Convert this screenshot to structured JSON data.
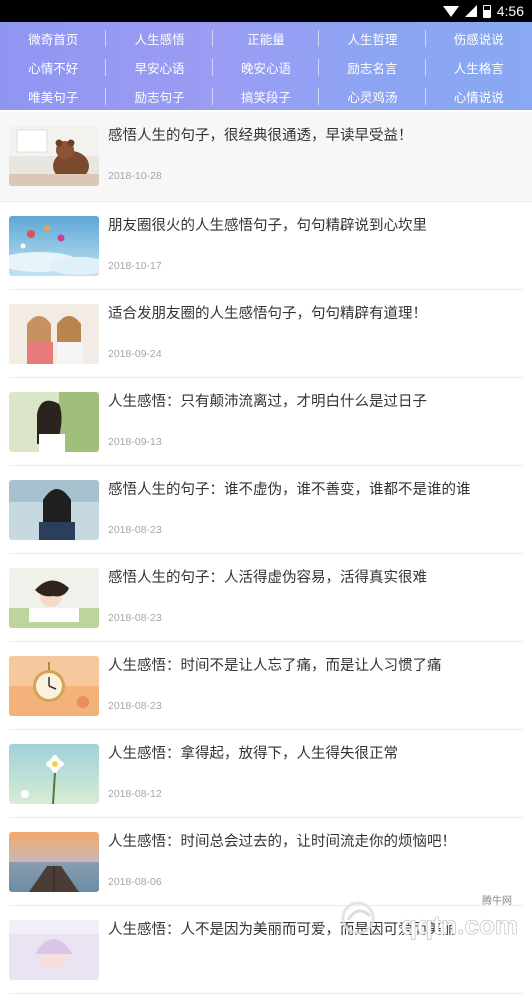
{
  "status_bar": {
    "time": "4:56",
    "battery_level": 0.6
  },
  "nav": [
    [
      "微奇首页",
      "人生感悟",
      "正能量",
      "人生哲理",
      "伤感说说"
    ],
    [
      "心情不好",
      "早安心语",
      "晚安心语",
      "励志名言",
      "人生格言"
    ],
    [
      "唯美句子",
      "励志句子",
      "搞笑段子",
      "心灵鸡汤",
      "心情说说"
    ]
  ],
  "articles": [
    {
      "title": "感悟人生的句子，很经典很通透，早读早受益！",
      "date": "2018-10-28",
      "thumb": "teddy-bear-window"
    },
    {
      "title": "朋友圈很火的人生感悟句子，句句精辟说到心坎里",
      "date": "2018-10-17",
      "thumb": "sky-balloons"
    },
    {
      "title": "适合发朋友圈的人生感悟句子，句句精辟有道理！",
      "date": "2018-09-24",
      "thumb": "two-girls"
    },
    {
      "title": "人生感悟：只有颠沛流离过，才明白什么是过日子",
      "date": "2018-09-13",
      "thumb": "girl-profile"
    },
    {
      "title": "感悟人生的句子：谁不虚伪，谁不善变，谁都不是谁的谁",
      "date": "2018-08-23",
      "thumb": "girl-glasses"
    },
    {
      "title": "感悟人生的句子：人活得虚伪容易，活得真实很难",
      "date": "2018-08-23",
      "thumb": "girl-lying"
    },
    {
      "title": "人生感悟：时间不是让人忘了痛，而是让人习惯了痛",
      "date": "2018-08-23",
      "thumb": "pocket-watch"
    },
    {
      "title": "人生感悟：拿得起，放得下，人生得失很正常",
      "date": "2018-08-12",
      "thumb": "white-flower"
    },
    {
      "title": "人生感悟：时间总会过去的，让时间流走你的烦恼吧！",
      "date": "2018-08-06",
      "thumb": "pier-sunset"
    },
    {
      "title": "人生感悟：人不是因为美丽而可爱，而是因可爱而美丽",
      "date": "",
      "thumb": "girl-pastel"
    }
  ],
  "watermark": {
    "site_label": "腾牛网",
    "domain_text": "qqtn.com"
  }
}
